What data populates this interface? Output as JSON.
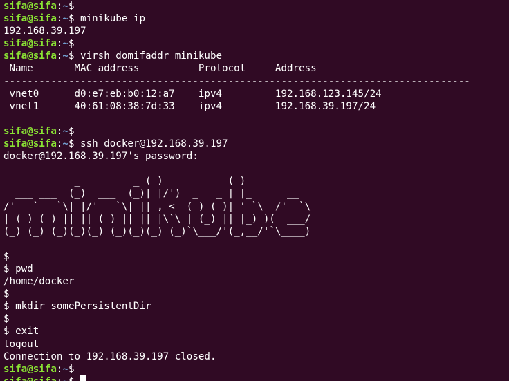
{
  "terminal": {
    "colors": {
      "background": "#300a24",
      "text": "#ffffff",
      "prompt_user": "#8ae234",
      "prompt_path": "#729fcf"
    },
    "prompt": {
      "userhost": "sifa@sifa",
      "sep": ":",
      "path": "~",
      "symbol": "$"
    },
    "lines": [
      {
        "type": "prompt",
        "cmd": ""
      },
      {
        "type": "prompt",
        "cmd": " minikube ip"
      },
      {
        "type": "text",
        "text": "192.168.39.197"
      },
      {
        "type": "prompt",
        "cmd": ""
      },
      {
        "type": "prompt",
        "cmd": " virsh domifaddr minikube"
      },
      {
        "type": "text",
        "text": " Name       MAC address          Protocol     Address"
      },
      {
        "type": "text",
        "text": "-------------------------------------------------------------------------------"
      },
      {
        "type": "text",
        "text": " vnet0      d0:e7:eb:b0:12:a7    ipv4         192.168.123.145/24"
      },
      {
        "type": "text",
        "text": " vnet1      40:61:08:38:7d:33    ipv4         192.168.39.197/24"
      },
      {
        "type": "text",
        "text": ""
      },
      {
        "type": "prompt",
        "cmd": ""
      },
      {
        "type": "prompt",
        "cmd": " ssh docker@192.168.39.197"
      },
      {
        "type": "text",
        "text": "docker@192.168.39.197's password:"
      },
      {
        "type": "text",
        "text": "                         _             _"
      },
      {
        "type": "text",
        "text": "            _         _ ( )           ( )"
      },
      {
        "type": "text",
        "text": "  ___ ___  (_)  ___  (_)| |/')  _   _ | |_      __"
      },
      {
        "type": "text",
        "text": "/' _ ` _ `\\| |/' _ `\\| || , <  ( ) ( )| '_`\\  /'__`\\"
      },
      {
        "type": "text",
        "text": "| ( ) ( ) || || ( ) || || |\\`\\ | (_) || |_) )(  ___/"
      },
      {
        "type": "text",
        "text": "(_) (_) (_)(_)(_) (_)(_)(_) (_)`\\___/'(_,__/'`\\____)"
      },
      {
        "type": "text",
        "text": ""
      },
      {
        "type": "text",
        "text": "$"
      },
      {
        "type": "text",
        "text": "$ pwd"
      },
      {
        "type": "text",
        "text": "/home/docker"
      },
      {
        "type": "text",
        "text": "$"
      },
      {
        "type": "text",
        "text": "$ mkdir somePersistentDir"
      },
      {
        "type": "text",
        "text": "$"
      },
      {
        "type": "text",
        "text": "$ exit"
      },
      {
        "type": "text",
        "text": "logout"
      },
      {
        "type": "text",
        "text": "Connection to 192.168.39.197 closed."
      },
      {
        "type": "prompt",
        "cmd": ""
      },
      {
        "type": "prompt",
        "cmd": " ",
        "cursor": true
      }
    ]
  }
}
